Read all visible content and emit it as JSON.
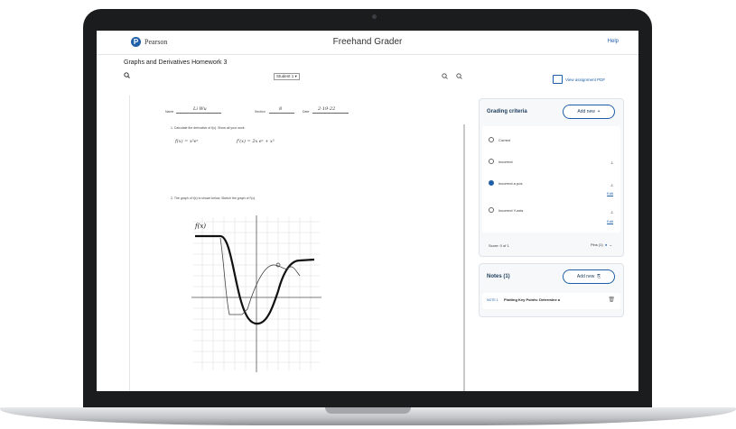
{
  "app": {
    "logo_text": "Pearson",
    "title": "Freehand Grader",
    "help": "Help"
  },
  "assignment": {
    "title": "Graphs and Derivatives Homework 3",
    "student_select": "Student 1 ▾",
    "view_pdf": "View assignment PDF"
  },
  "document": {
    "name_label": "Name",
    "name_value": "Li Wu",
    "section_label": "Section",
    "section_value": "8",
    "date_label": "Date",
    "date_value": "2-19-22",
    "q1": "1.  Calculate the derivative of f(x). Show all your work.",
    "work_left": "f(x) = x²eˣ",
    "work_right": "f'(x) = 2x eˣ + x²",
    "q2": "2.  The graph of f(x) is shown below. Sketch the graph of f'(x).",
    "graph_label": "f(x)"
  },
  "grading": {
    "title": "Grading criteria",
    "add_new": "Add new",
    "criteria": [
      {
        "label": "Correct",
        "points": "",
        "selected": false,
        "edit": ""
      },
      {
        "label": "Incorrect",
        "points": "-1",
        "selected": false,
        "edit": ""
      },
      {
        "label": "Incorrect a pos",
        "points": "-1",
        "selected": true,
        "edit": "Edit"
      },
      {
        "label": "Incorrect Y-axis",
        "points": "-1",
        "selected": false,
        "edit": "Edit"
      }
    ],
    "score": "Score: 0 of 1",
    "pins": "Pins (1)"
  },
  "notes": {
    "title": "Notes (1)",
    "add_new": "Add new",
    "items": [
      {
        "label": "NOTE 1",
        "text": "Plotting Key Points: Determine a"
      }
    ]
  },
  "colors": {
    "brand": "#1f5fa8",
    "panel_bg": "#f6f8fa",
    "heading": "#1d3b5a"
  }
}
